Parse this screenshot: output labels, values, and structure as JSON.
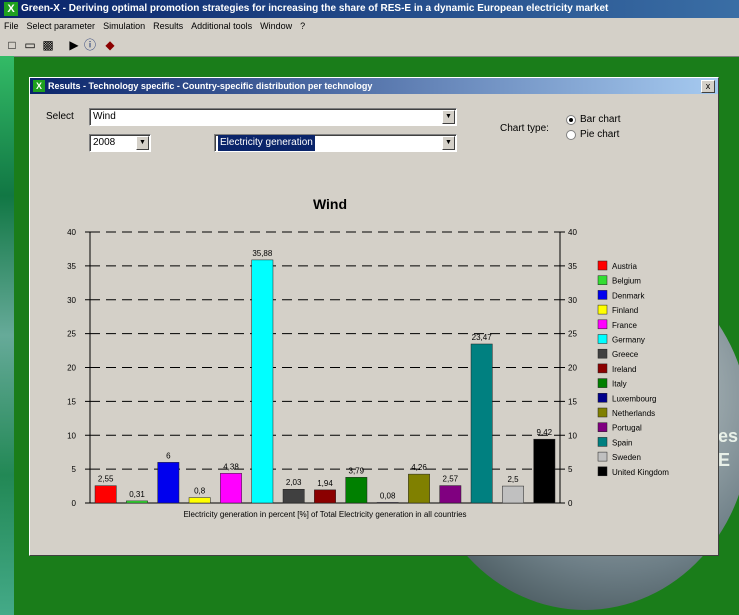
{
  "app": {
    "title": "Green-X - Deriving optimal promotion strategies for increasing the share of RES-E in a dynamic European electricity market",
    "menu": [
      "File",
      "Select parameter",
      "Simulation",
      "Results",
      "Additional tools",
      "Window",
      "?"
    ],
    "toolbar_icons": [
      "new-file-icon",
      "open-folder-icon",
      "print-icon",
      "run-icon",
      "info-icon",
      "book-icon"
    ]
  },
  "background": {
    "text_fragments": [
      "es",
      "E"
    ]
  },
  "dialog": {
    "title": "Results - Technology specific - Country-specific distribution per technology",
    "close_label": "x",
    "select_label": "Select",
    "technology_value": "Wind",
    "year_value": "2008",
    "indicator_value": "Electricity generation",
    "chart_type_label": "Chart type:",
    "chart_type_options": [
      "Bar chart",
      "Pie chart"
    ],
    "chart_type_selected": "Bar chart"
  },
  "chart_data": {
    "type": "bar",
    "title": "Wind",
    "xlabel": "Electricity generation in percent [%] of Total Electricity generation in all countries",
    "ylim": [
      0,
      40
    ],
    "yticks": [
      0,
      5,
      10,
      15,
      20,
      25,
      30,
      35,
      40
    ],
    "grid": true,
    "legend_position": "right",
    "categories": [
      "Austria",
      "Belgium",
      "Denmark",
      "Finland",
      "France",
      "Germany",
      "Greece",
      "Ireland",
      "Italy",
      "Luxembourg",
      "Netherlands",
      "Portugal",
      "Spain",
      "Sweden",
      "United Kingdom"
    ],
    "values": [
      2.55,
      0.31,
      6,
      0.8,
      4.38,
      35.88,
      2.03,
      1.94,
      3.79,
      0.08,
      4.26,
      2.57,
      23.47,
      2.5,
      9.42
    ],
    "value_labels": [
      "2,55",
      "0,31",
      "6",
      "0,8",
      "4,38",
      "35,88",
      "2,03",
      "1,94",
      "3,79",
      "0,08",
      "4,26",
      "2,57",
      "23,47",
      "2,5",
      "9,42"
    ],
    "colors": [
      "#ff0000",
      "#33dd33",
      "#0000ee",
      "#ffff00",
      "#ff00ff",
      "#00ffff",
      "#404040",
      "#8b0000",
      "#008000",
      "#00008b",
      "#808000",
      "#800080",
      "#008080",
      "#c0c0c0",
      "#000000"
    ]
  }
}
